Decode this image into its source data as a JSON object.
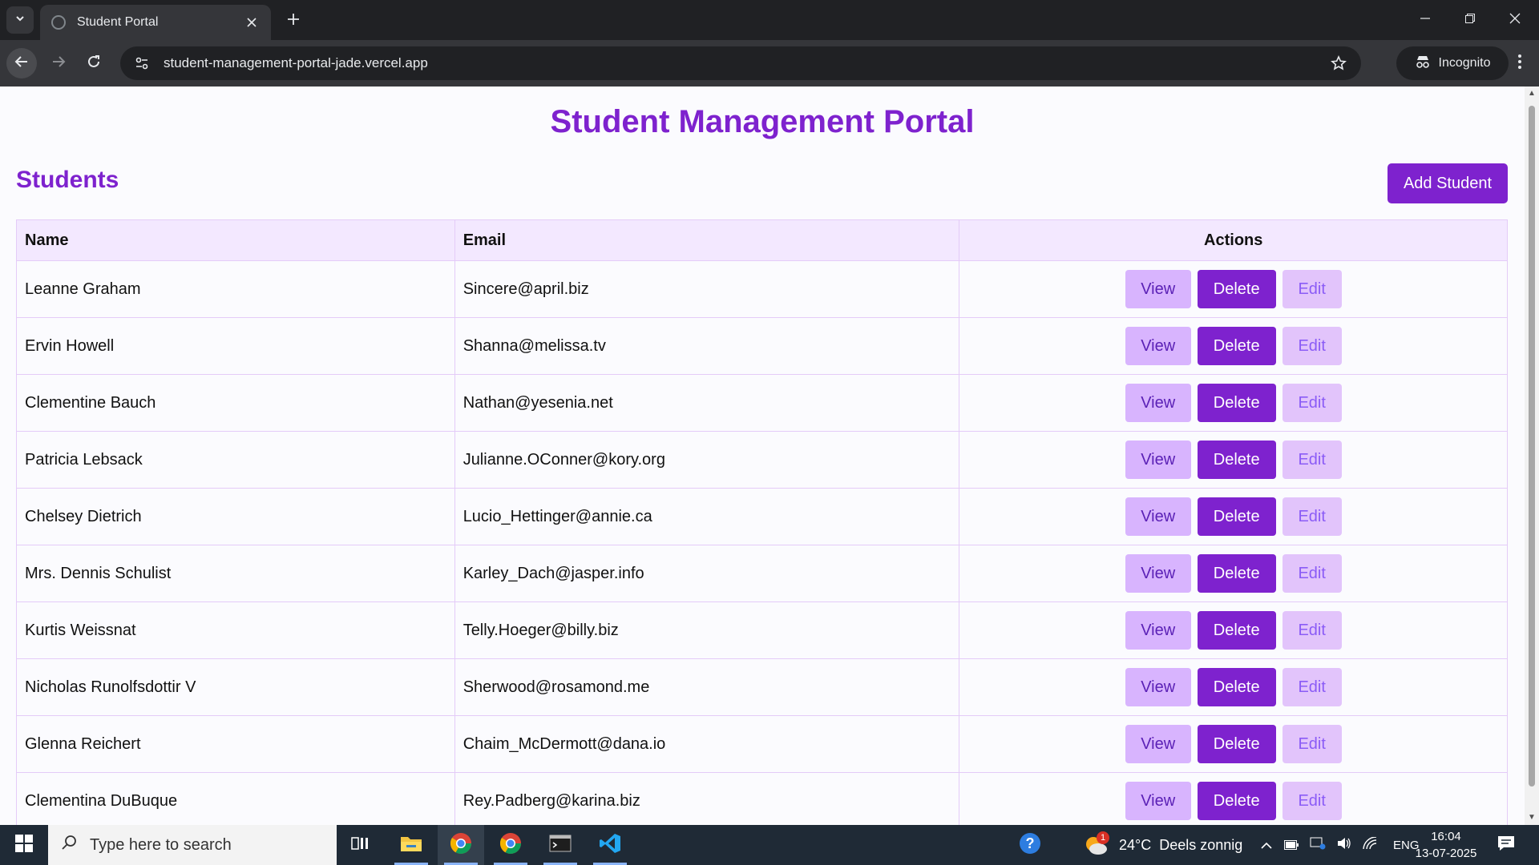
{
  "browser": {
    "tab_title": "Student Portal",
    "url": "student-management-portal-jade.vercel.app",
    "incognito_label": "Incognito"
  },
  "page": {
    "title": "Student Management Portal",
    "section_title": "Students",
    "add_button": "Add Student",
    "columns": {
      "name": "Name",
      "email": "Email",
      "actions": "Actions"
    },
    "actions": {
      "view": "View",
      "delete": "Delete",
      "edit": "Edit"
    },
    "students": [
      {
        "name": "Leanne Graham",
        "email": "Sincere@april.biz"
      },
      {
        "name": "Ervin Howell",
        "email": "Shanna@melissa.tv"
      },
      {
        "name": "Clementine Bauch",
        "email": "Nathan@yesenia.net"
      },
      {
        "name": "Patricia Lebsack",
        "email": "Julianne.OConner@kory.org"
      },
      {
        "name": "Chelsey Dietrich",
        "email": "Lucio_Hettinger@annie.ca"
      },
      {
        "name": "Mrs. Dennis Schulist",
        "email": "Karley_Dach@jasper.info"
      },
      {
        "name": "Kurtis Weissnat",
        "email": "Telly.Hoeger@billy.biz"
      },
      {
        "name": "Nicholas Runolfsdottir V",
        "email": "Sherwood@rosamond.me"
      },
      {
        "name": "Glenna Reichert",
        "email": "Chaim_McDermott@dana.io"
      },
      {
        "name": "Clementina DuBuque",
        "email": "Rey.Padberg@karina.biz"
      }
    ]
  },
  "taskbar": {
    "search_placeholder": "Type here to search",
    "weather": "24°C  Deels zonnig",
    "weather_badge": "1",
    "language": "ENG",
    "time": "16:04",
    "date": "13-07-2025"
  },
  "colors": {
    "accent": "#7e22ce",
    "header_bg": "#f3e8ff",
    "view_bg": "#d8b4fe",
    "edit_bg": "#e2c4fb"
  }
}
